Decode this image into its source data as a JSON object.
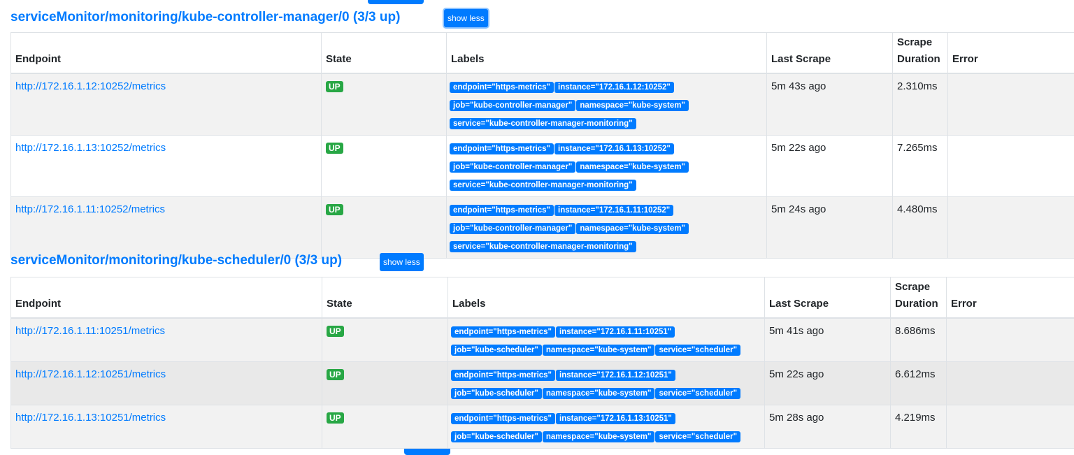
{
  "sections": [
    {
      "title": "serviceMonitor/monitoring/kube-controller-manager/0 (3/3 up)",
      "button": "show less",
      "headers": [
        "Endpoint",
        "State",
        "Labels",
        "Last Scrape",
        "Scrape Duration",
        "Error"
      ],
      "rows": [
        {
          "endpoint": "http://172.16.1.12:10252/metrics",
          "state": "UP",
          "labels": [
            "endpoint=\"https-metrics\"",
            "instance=\"172.16.1.12:10252\"",
            "job=\"kube-controller-manager\"",
            "namespace=\"kube-system\"",
            "service=\"kube-controller-manager-monitoring\""
          ],
          "last_scrape": "5m 43s ago",
          "duration": "2.310ms",
          "error": ""
        },
        {
          "endpoint": "http://172.16.1.13:10252/metrics",
          "state": "UP",
          "labels": [
            "endpoint=\"https-metrics\"",
            "instance=\"172.16.1.13:10252\"",
            "job=\"kube-controller-manager\"",
            "namespace=\"kube-system\"",
            "service=\"kube-controller-manager-monitoring\""
          ],
          "last_scrape": "5m 22s ago",
          "duration": "7.265ms",
          "error": ""
        },
        {
          "endpoint": "http://172.16.1.11:10252/metrics",
          "state": "UP",
          "labels": [
            "endpoint=\"https-metrics\"",
            "instance=\"172.16.1.11:10252\"",
            "job=\"kube-controller-manager\"",
            "namespace=\"kube-system\"",
            "service=\"kube-controller-manager-monitoring\""
          ],
          "last_scrape": "5m 24s ago",
          "duration": "4.480ms",
          "error": ""
        }
      ]
    },
    {
      "title": "serviceMonitor/monitoring/kube-scheduler/0 (3/3 up)",
      "button": "show less",
      "headers": [
        "Endpoint",
        "State",
        "Labels",
        "Last Scrape",
        "Scrape Duration",
        "Error"
      ],
      "rows": [
        {
          "endpoint": "http://172.16.1.11:10251/metrics",
          "state": "UP",
          "labels": [
            "endpoint=\"https-metrics\"",
            "instance=\"172.16.1.11:10251\"",
            "job=\"kube-scheduler\"",
            "namespace=\"kube-system\"",
            "service=\"scheduler\""
          ],
          "last_scrape": "5m 41s ago",
          "duration": "8.686ms",
          "error": ""
        },
        {
          "endpoint": "http://172.16.1.12:10251/metrics",
          "state": "UP",
          "labels": [
            "endpoint=\"https-metrics\"",
            "instance=\"172.16.1.12:10251\"",
            "job=\"kube-scheduler\"",
            "namespace=\"kube-system\"",
            "service=\"scheduler\""
          ],
          "last_scrape": "5m 22s ago",
          "duration": "6.612ms",
          "error": ""
        },
        {
          "endpoint": "http://172.16.1.13:10251/metrics",
          "state": "UP",
          "labels": [
            "endpoint=\"https-metrics\"",
            "instance=\"172.16.1.13:10251\"",
            "job=\"kube-scheduler\"",
            "namespace=\"kube-system\"",
            "service=\"scheduler\""
          ],
          "last_scrape": "5m 28s ago",
          "duration": "4.219ms",
          "error": ""
        }
      ]
    }
  ]
}
